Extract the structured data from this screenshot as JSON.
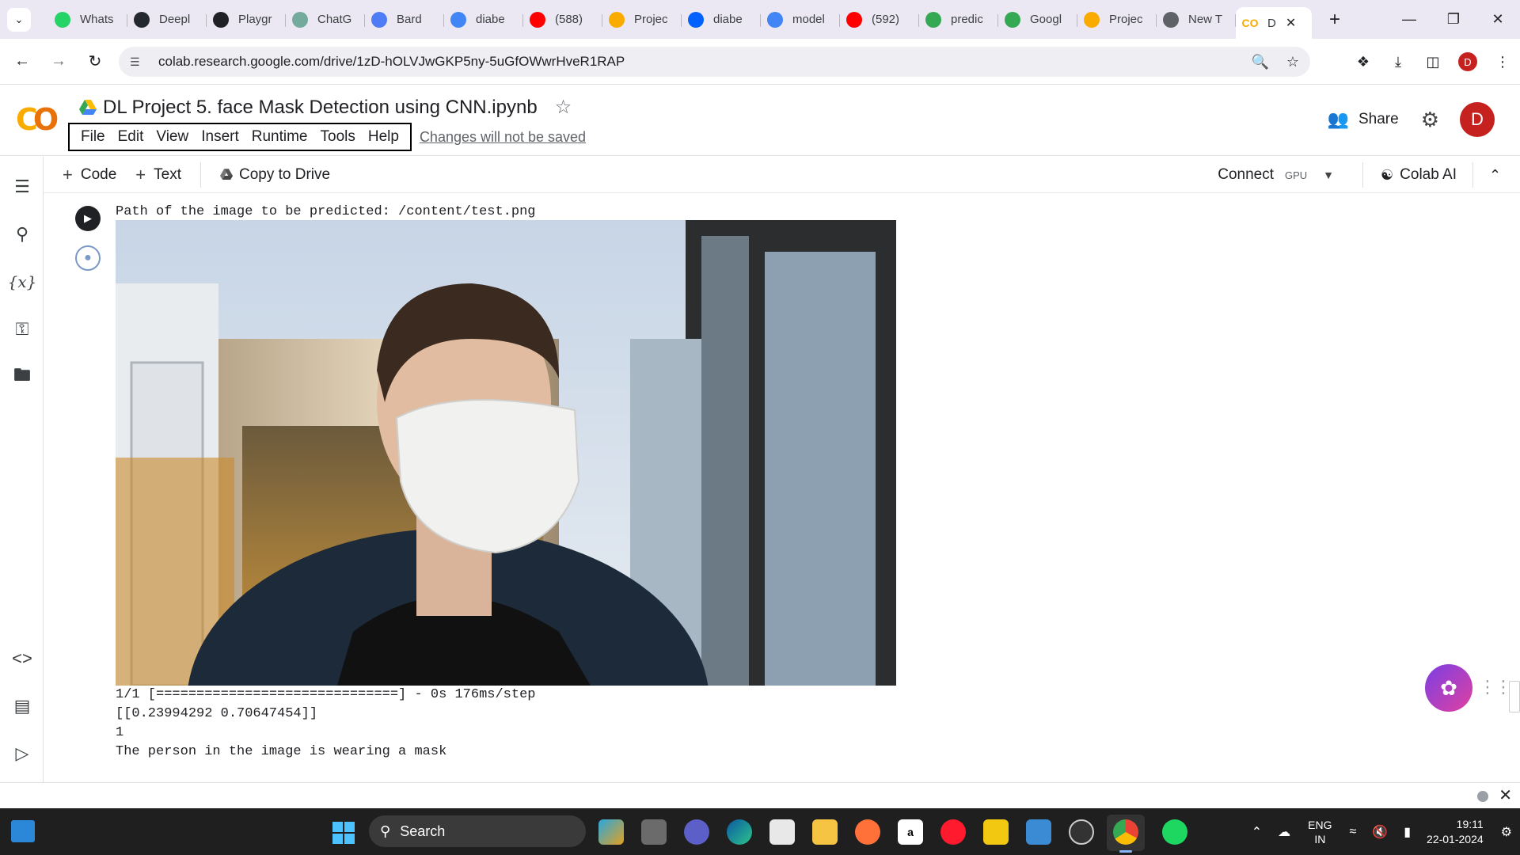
{
  "browser": {
    "tabs": [
      {
        "label": "Whats",
        "icon": "whatsapp-icon",
        "color": "#25d366"
      },
      {
        "label": "Deepl",
        "icon": "github-icon",
        "color": "#24292f"
      },
      {
        "label": "Playgr",
        "icon": "openai-icon",
        "color": "#202124"
      },
      {
        "label": "ChatG",
        "icon": "chatgpt-icon",
        "color": "#74aa9c"
      },
      {
        "label": "Bard",
        "icon": "bard-icon",
        "color": "#4e7cf6"
      },
      {
        "label": "diabe",
        "icon": "google-icon",
        "color": "#4285f4"
      },
      {
        "label": "(588)",
        "icon": "youtube-icon",
        "color": "#ff0000"
      },
      {
        "label": "Projec",
        "icon": "colab-icon",
        "color": "#f9ab00"
      },
      {
        "label": "diabe",
        "icon": "dropbox-icon",
        "color": "#0061fe"
      },
      {
        "label": "model",
        "icon": "google-icon",
        "color": "#4285f4"
      },
      {
        "label": "(592)",
        "icon": "youtube-icon",
        "color": "#ff0000"
      },
      {
        "label": "predic",
        "icon": "drive-icon",
        "color": "#34a853"
      },
      {
        "label": "Googl",
        "icon": "drive-icon",
        "color": "#34a853"
      },
      {
        "label": "Projec",
        "icon": "colab-icon",
        "color": "#f9ab00"
      },
      {
        "label": "New T",
        "icon": "chrome-icon",
        "color": "#5f6368"
      }
    ],
    "active_tab": {
      "label": "D",
      "icon": "colab-icon",
      "color": "#f9ab00"
    },
    "url": "colab.research.google.com/drive/1zD-hOLVJwGKP5ny-5uGfOWwrHveR1RAP",
    "profile_initial": "D"
  },
  "colab": {
    "title": "DL Project 5. face Mask Detection using CNN.ipynb",
    "menu": [
      "File",
      "Edit",
      "View",
      "Insert",
      "Runtime",
      "Tools",
      "Help"
    ],
    "unsaved_notice": "Changes will not be saved",
    "share_label": "Share",
    "user_initial": "D",
    "toolbar": {
      "code_label": "Code",
      "text_label": "Text",
      "copy_label": "Copy to Drive",
      "connect_label": "Connect",
      "gpu_label": "GPU",
      "ai_label": "Colab AI"
    }
  },
  "output": {
    "path_line": "Path of the image to be predicted: /content/test.png",
    "progress_line": "1/1 [==============================] - 0s 176ms/step",
    "prediction_line": "[[0.23994292 0.70647454]]",
    "label_line": "1",
    "result_line": "The person in the image is wearing a mask"
  },
  "taskbar": {
    "search_label": "Search",
    "lang_line1": "ENG",
    "lang_line2": "IN",
    "time": "19:11",
    "date": "22-01-2024"
  },
  "colors": {
    "accent": "#f9ab00",
    "profile": "#c5221f",
    "taskbar": "#1f1f1f"
  }
}
